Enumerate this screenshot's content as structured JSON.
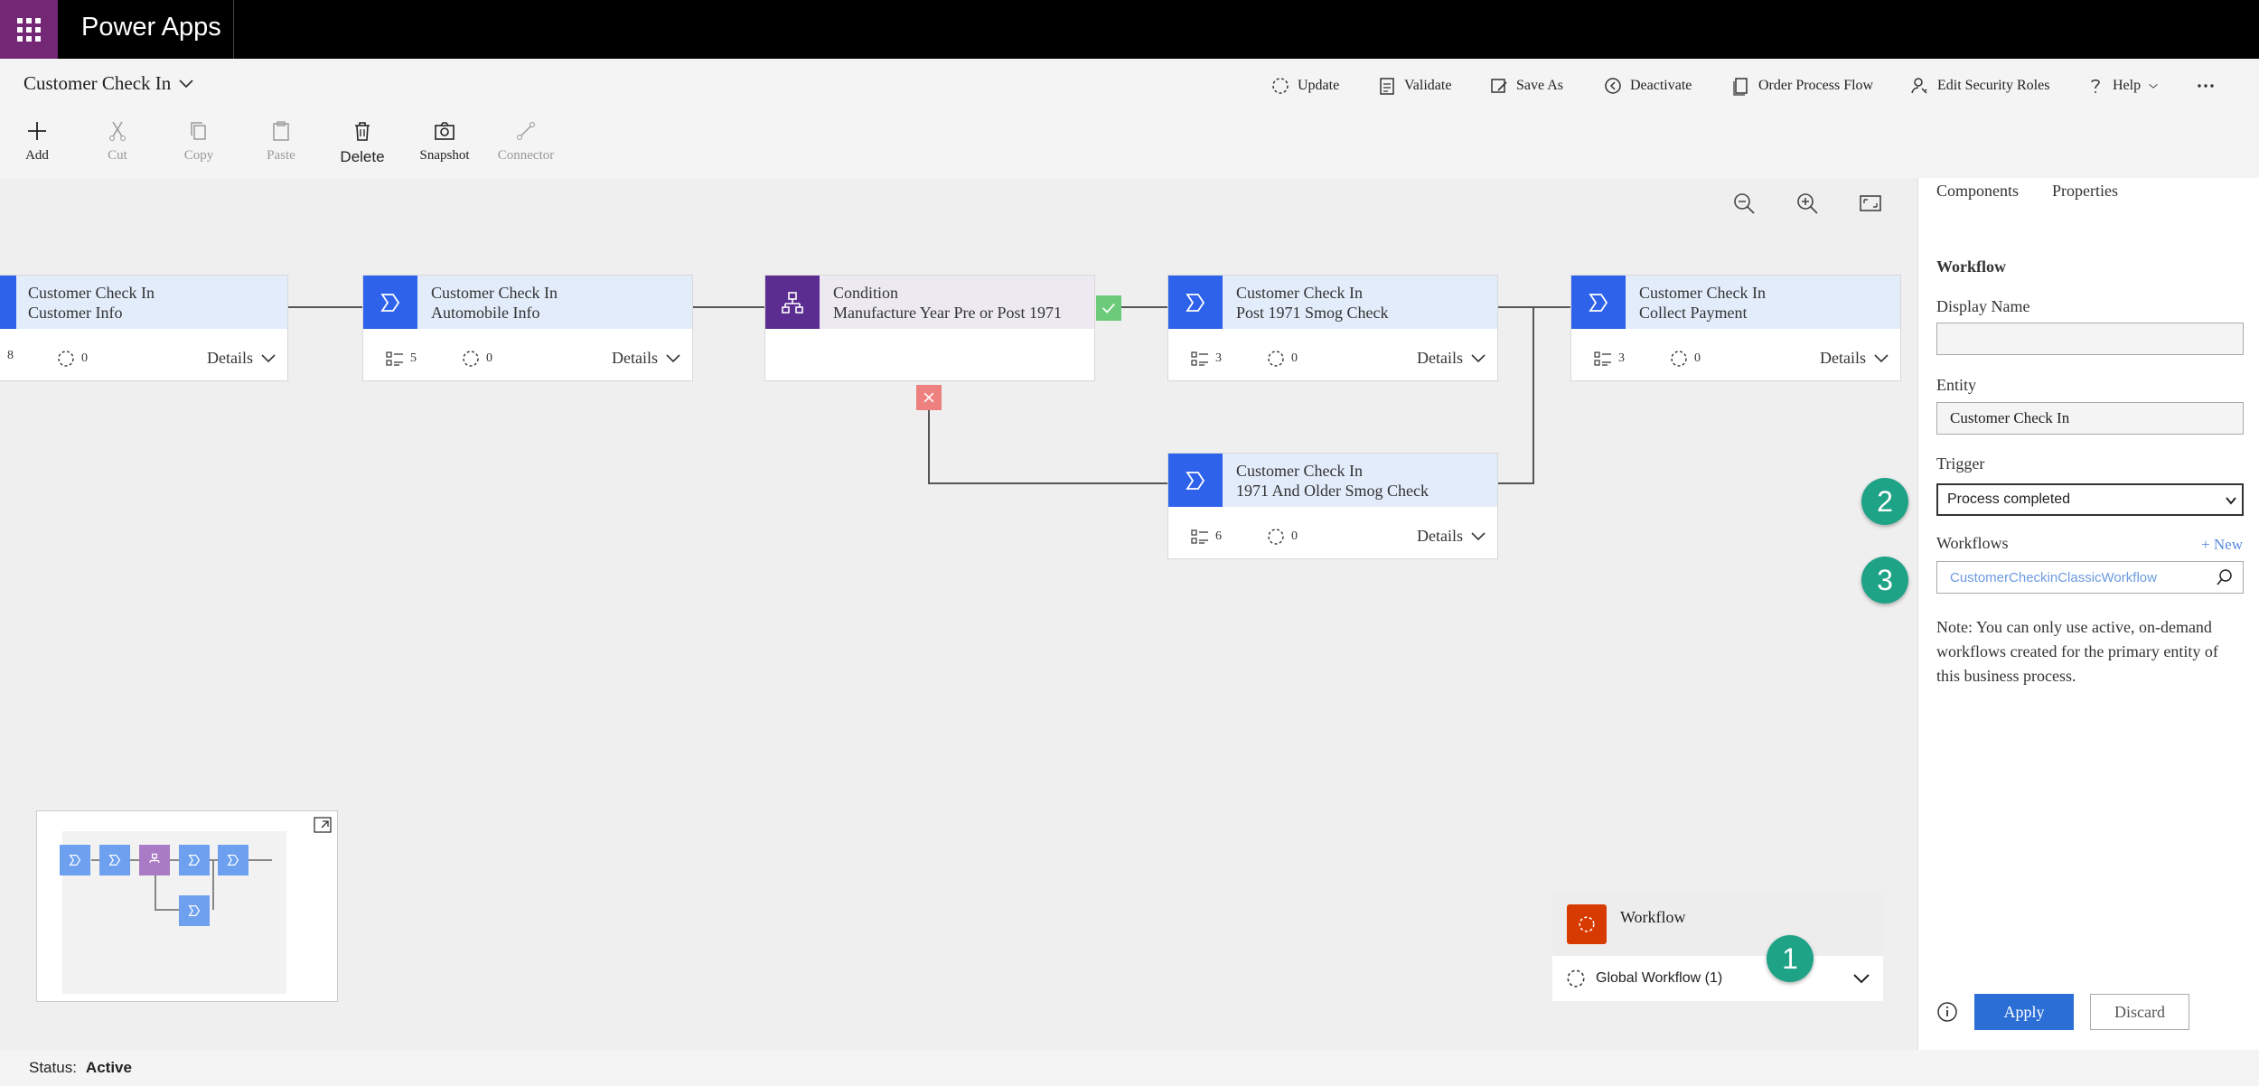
{
  "app": {
    "name": "Power Apps"
  },
  "header": {
    "title": "Customer Check In"
  },
  "commands": [
    {
      "label": "Update"
    },
    {
      "label": "Validate"
    },
    {
      "label": "Save As"
    },
    {
      "label": "Deactivate"
    },
    {
      "label": "Order Process Flow"
    },
    {
      "label": "Edit Security Roles"
    },
    {
      "label": "Help"
    }
  ],
  "toolbar": {
    "add": "Add",
    "cut": "Cut",
    "copy": "Copy",
    "paste": "Paste",
    "delete": "Delete",
    "snapshot": "Snapshot",
    "connector": "Connector"
  },
  "stages": [
    {
      "line1": "Customer Check In",
      "line2": "Customer Info",
      "steps": "8",
      "flows": "0",
      "details": "Details"
    },
    {
      "line1": "Customer Check In",
      "line2": "Automobile Info",
      "steps": "5",
      "flows": "0",
      "details": "Details"
    },
    {
      "line1": "Condition",
      "line2": "Manufacture Year Pre or Post 1971"
    },
    {
      "line1": "Customer Check In",
      "line2": "Post 1971 Smog Check",
      "steps": "3",
      "flows": "0",
      "details": "Details"
    },
    {
      "line1": "Customer Check In",
      "line2": "Collect Payment",
      "steps": "3",
      "flows": "0",
      "details": "Details"
    },
    {
      "line1": "Customer Check In",
      "line2": "1971 And Older Smog Check",
      "steps": "6",
      "flows": "0",
      "details": "Details"
    }
  ],
  "workflow_panel": {
    "title": "Workflow",
    "item": "Global Workflow (1)"
  },
  "badges": [
    "1",
    "2",
    "3"
  ],
  "side": {
    "tabs": [
      "Components",
      "Properties"
    ],
    "section": "Workflow",
    "display_name_label": "Display Name",
    "display_name_value": "",
    "entity_label": "Entity",
    "entity_value": "Customer Check In",
    "trigger_label": "Trigger",
    "trigger_value": "Process completed",
    "workflows_label": "Workflows",
    "new_label": "+ New",
    "workflow_value": "CustomerCheckinClassicWorkflow",
    "note": "Note: You can only use active, on-demand workflows created for the primary entity of this business process.",
    "apply": "Apply",
    "discard": "Discard"
  },
  "status": {
    "label": "Status:",
    "value": "Active"
  },
  "colors": {
    "topbar": "#000000",
    "waffle": "#742774",
    "stage_icon": "#2f62ea",
    "condition_icon": "#5c2d91",
    "badge": "#1fa387",
    "apply": "#2b6fd6",
    "workflow_icon": "#d83b01"
  }
}
